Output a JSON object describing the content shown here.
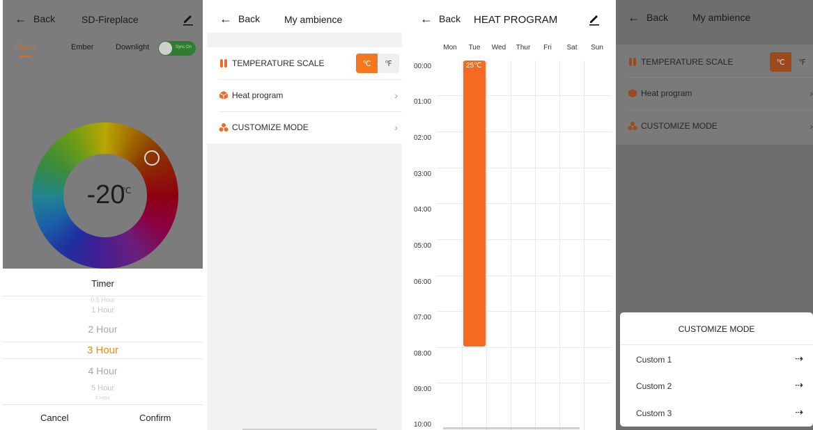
{
  "panel1": {
    "back_label": "Back",
    "title": "SD-Fireplace",
    "tabs": [
      "Flame",
      "Ember",
      "Downlight"
    ],
    "active_tab": "Flame",
    "sync_toggle_label": "Sync On",
    "temperature": "-20",
    "temperature_unit": "℃",
    "timer": {
      "title": "Timer",
      "options": [
        "0.5 Hour",
        "1 Hour",
        "2 Hour",
        "3 Hour",
        "4 Hour",
        "5 Hour",
        "6 Hour"
      ],
      "selected": "3 Hour",
      "cancel_label": "Cancel",
      "confirm_label": "Confirm"
    }
  },
  "panel2": {
    "back_label": "Back",
    "title": "My ambience",
    "menu": [
      {
        "label": "TEMPERATURE SCALE",
        "icon": "thermo-bars-icon"
      },
      {
        "label": "Heat program",
        "icon": "cube-icon"
      },
      {
        "label": "CUSTOMIZE MODE",
        "icon": "dots-cluster-icon"
      }
    ],
    "unit_celsius": "℃",
    "unit_fahrenheit": "℉",
    "selected_unit": "celsius"
  },
  "panel3": {
    "back_label": "Back",
    "title": "HEAT PROGRAM",
    "days": [
      "Mon",
      "Tue",
      "Wed",
      "Thur",
      "Fri",
      "Sat",
      "Sun"
    ],
    "times": [
      "00:00",
      "01:00",
      "02:00",
      "03:00",
      "04:00",
      "05:00",
      "06:00",
      "07:00",
      "08:00",
      "09:00",
      "10:00"
    ],
    "program": {
      "day": "Tue",
      "start": "00:00",
      "end": "08:00",
      "temperature": "25℃"
    }
  },
  "panel4": {
    "back_label": "Back",
    "title": "My ambience",
    "customize_sheet": {
      "title": "CUSTOMIZE MODE",
      "options": [
        "Custom 1",
        "Custom 2",
        "Custom 3"
      ],
      "arrow_glyph": "⇢"
    }
  },
  "colors": {
    "accent": "#f56a23",
    "picker_selected": "#e08a1d",
    "toggle_on": "#2f7d30"
  }
}
